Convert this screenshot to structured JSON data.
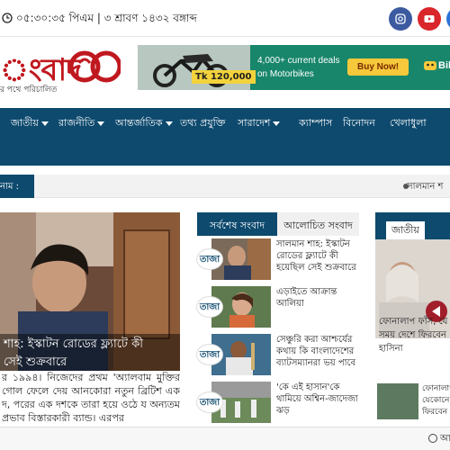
{
  "topbar": {
    "datetime": "০৫:৩০:৩৫ পিএম | ৩ শ্রাবণ ১৪৩২ বঙ্গাব্দ",
    "social": [
      {
        "icon": "instagram-icon",
        "color": "#3b5aa0"
      },
      {
        "icon": "youtube-icon",
        "color": "#d9262b"
      },
      {
        "icon": "pinterest-icon",
        "color": "#c61d27"
      },
      {
        "icon": "facebook-icon",
        "color": "#2e74d8"
      }
    ]
  },
  "logo": {
    "text": "ংবাদ",
    "tagline": "র পথে পরিচালিত",
    "brand_color": "#c0181f"
  },
  "ad": {
    "price": "Tk 120,000",
    "line1": "4,000+ current deals",
    "line2": "on Motorbikes",
    "button": "Buy Now!",
    "brand": "Bik"
  },
  "nav": {
    "items": [
      {
        "label": "জাতীয়",
        "dropdown": true
      },
      {
        "label": "রাজনীতি",
        "dropdown": true
      },
      {
        "label": "আন্তর্জাতিক",
        "dropdown": true
      },
      {
        "label": "তথ্য প্রযুক্তি",
        "dropdown": false
      },
      {
        "label": "সারাদেশ",
        "dropdown": true
      },
      {
        "label": "ক্যাম্পাস",
        "dropdown": false
      },
      {
        "label": "বিনোদন",
        "dropdown": false
      },
      {
        "label": "খেলাধুলা",
        "dropdown": false
      }
    ],
    "bg_color": "#0e4a6e"
  },
  "ticker": {
    "label": "নাম :",
    "text": "সালমান শ"
  },
  "feature": {
    "title_line1": "শাহ: ইস্কাটন রোডের ফ্ল্যাটে কী",
    "title_line2": "সেই শুক্রবারে",
    "body": "র ১৯৯৪। নিজেদের প্রথম 'অ্যালবাম মুক্তির গোল ফেলে দেয় আনকোরা নতুন ব্রিটিশ এক দ, পরের এক দশকে তারা হয়ে ওঠে য অন্যতম প্রভাব বিস্তারকারী ব্যান্ড। এরপর"
  },
  "tabs": {
    "latest": "সর্বশেষ সংবাদ",
    "popular": "আলোচিত সংবাদ"
  },
  "news": [
    {
      "tag": "তাজা",
      "title": "সালমান শাহ: ইস্কাটন রোডের ফ্ল্যাটে কী হয়েছিল সেই শুক্রবারে"
    },
    {
      "tag": "তাজা",
      "title": "এড়াইতে আক্রান্ত আলিয়া"
    },
    {
      "tag": "তাজা",
      "title": "সেঞ্চুরি করা আশ্চর্যের কথায় কি বাংলাদেশের ব্যাটসম্যানরা ভয় পাবে"
    },
    {
      "tag": "তাজা",
      "title": "'কে এই হাসান'কে থামিয়ে অশ্বিন-জাদেজা ঝড়"
    }
  ],
  "right": {
    "header": "জাতীয়",
    "text_line1": "ফোনালাপ ফাঁস, যে",
    "text_line2": "সময় দেশে ফিরবেন",
    "text_line3": "হাসিনা",
    "small_line1": "ফোনালাপ",
    "small_line2": "যেকোনে",
    "small_line3": "ফিরবেন"
  },
  "bottom": {
    "text": "আ"
  }
}
